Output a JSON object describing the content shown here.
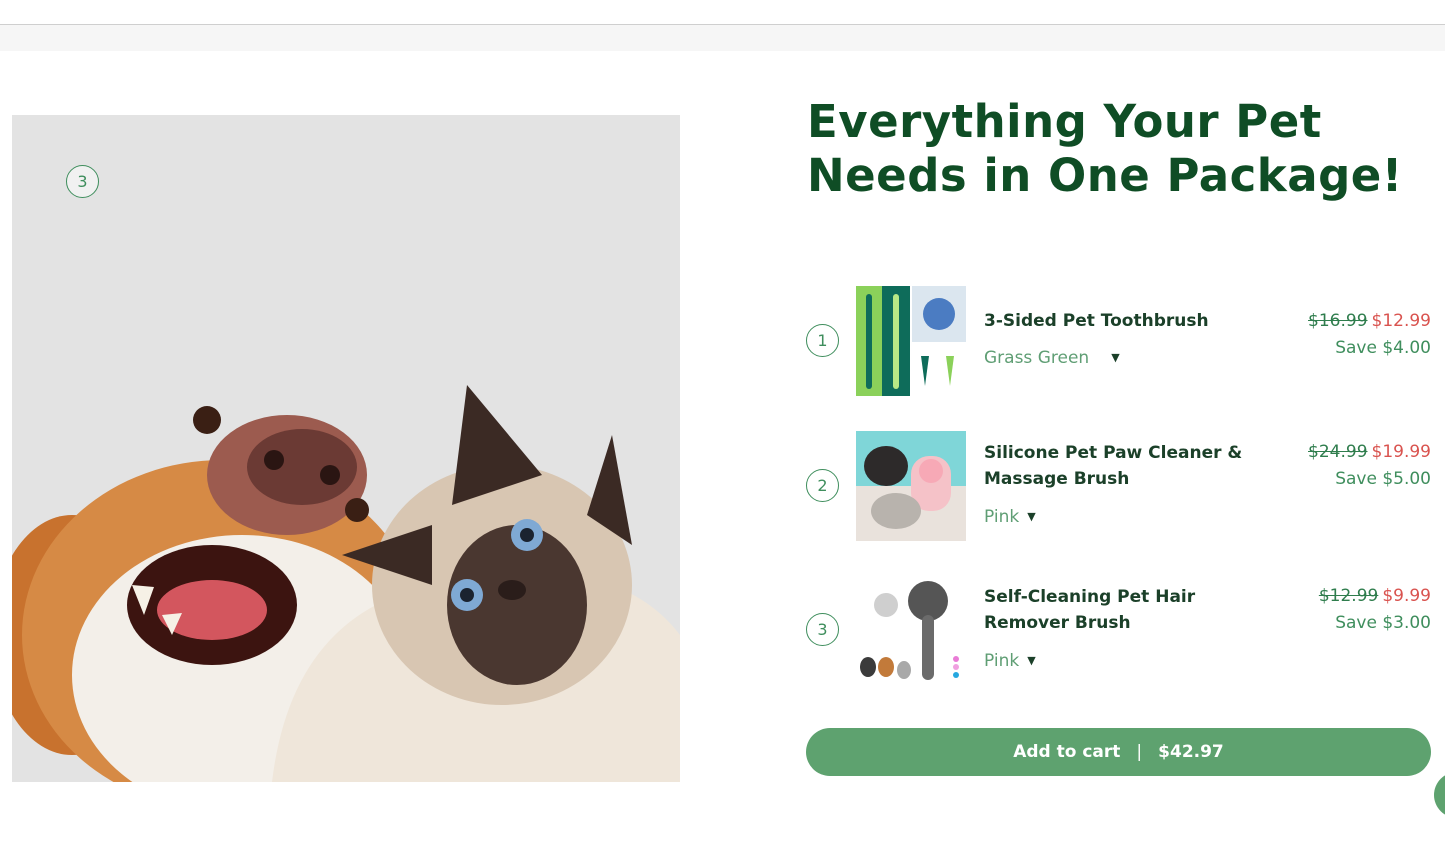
{
  "hero": {
    "badge": "3"
  },
  "title": "Everything Your Pet Needs in One Package!",
  "items": [
    {
      "number": "1",
      "name": "3-Sided Pet Toothbrush",
      "variant": "Grass Green",
      "old_price": "$16.99",
      "new_price": "$12.99",
      "save": "Save $4.00",
      "thumb_icon": "toothbrush-image"
    },
    {
      "number": "2",
      "name": "Silicone Pet Paw Cleaner & Massage Brush",
      "variant": "Pink",
      "old_price": "$24.99",
      "new_price": "$19.99",
      "save": "Save $5.00",
      "thumb_icon": "paw-cleaner-image"
    },
    {
      "number": "3",
      "name": "Self-Cleaning Pet Hair Remover Brush",
      "variant": "Pink",
      "old_price": "$12.99",
      "new_price": "$9.99",
      "save": "Save $3.00",
      "thumb_icon": "hair-brush-image"
    }
  ],
  "cart": {
    "label": "Add to cart",
    "separator": "|",
    "total": "$42.97"
  },
  "colors": {
    "title": "#0f4d25",
    "accent": "#5ea26f",
    "sale": "#d9534f",
    "variant": "#5f9e74"
  }
}
